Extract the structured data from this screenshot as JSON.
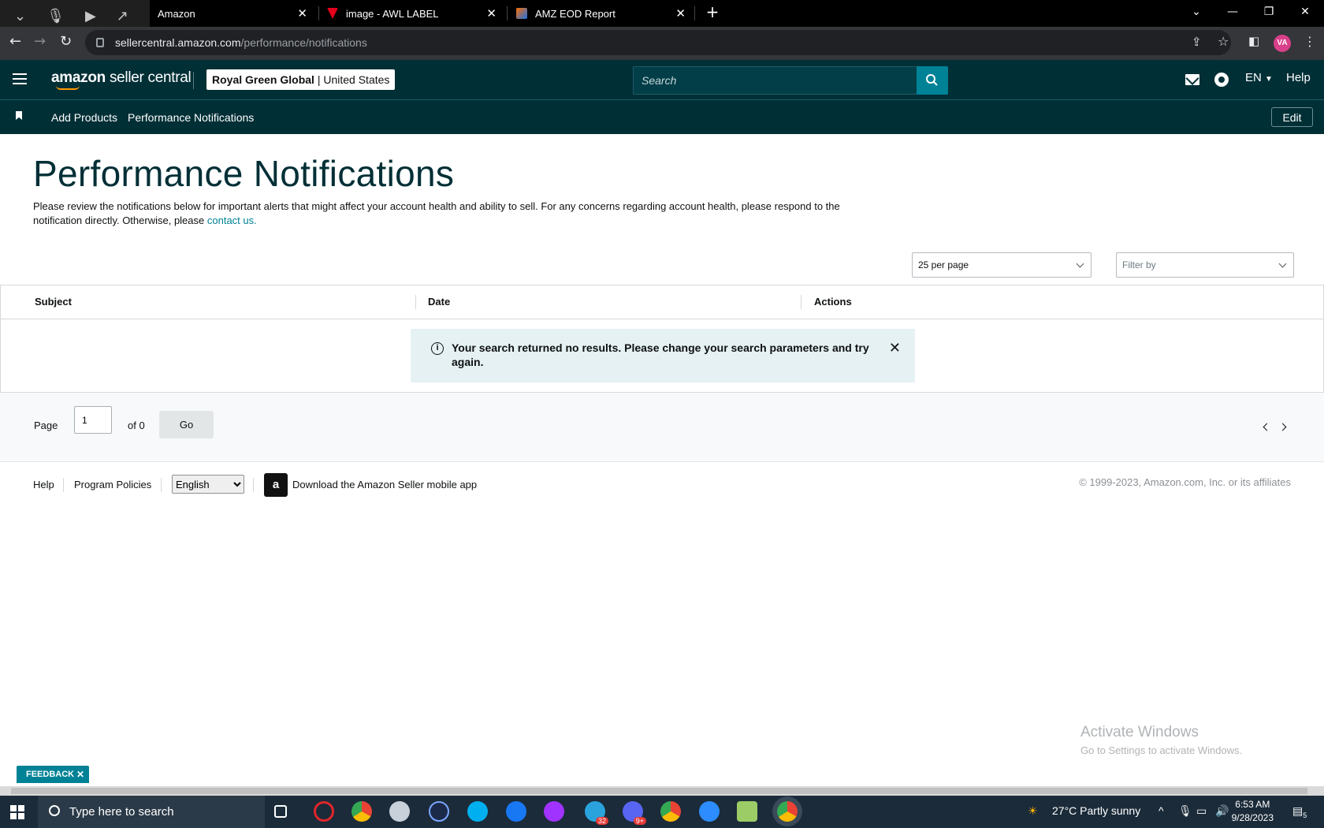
{
  "browser": {
    "tabs": [
      {
        "title": "Amazon",
        "favicon_color": "#1f1f1f"
      },
      {
        "title": "image - AWL LABEL",
        "favicon_color": "#e2001a"
      },
      {
        "title": "AMZ EOD Report",
        "favicon_color": "#ff6d00"
      }
    ],
    "url_host": "sellercentral.amazon.com",
    "url_path": "/performance/notifications",
    "profile_initials": "VA"
  },
  "header": {
    "logo_brand": "amazon",
    "logo_suffix": "seller central",
    "account_name": "Royal Green Global",
    "account_region": "United States",
    "search_placeholder": "Search",
    "language": "EN",
    "help": "Help"
  },
  "subnav": {
    "links": [
      "Add Products",
      "Performance Notifications"
    ],
    "edit": "Edit"
  },
  "page": {
    "title": "Performance Notifications",
    "intro": "Please review the notifications below for important alerts that might affect your account health and ability to sell. For any concerns regarding account health, please respond to the notification directly. Otherwise, please ",
    "intro_link": "contact us.",
    "per_page": "25 per page",
    "filter_placeholder": "Filter by"
  },
  "table": {
    "columns": [
      "Subject",
      "Date",
      "Actions"
    ],
    "empty_message": "Your search returned no results. Please change your search parameters and try again."
  },
  "pager": {
    "page_label": "Page",
    "current_page": "1",
    "of_label": "of 0",
    "go": "Go"
  },
  "footer": {
    "help": "Help",
    "policies": "Program Policies",
    "language_option": "English",
    "app_text": "Download the Amazon Seller mobile app",
    "copyright": "© 1999-2023, Amazon.com, Inc. or its affiliates"
  },
  "watermark": {
    "line1": "Activate Windows",
    "line2": "Go to Settings to activate Windows."
  },
  "feedback": "FEEDBACK",
  "taskbar": {
    "search_placeholder": "Type here to search",
    "weather": "27°C  Partly sunny",
    "time": "6:53 AM",
    "date": "9/28/2023",
    "notification_count": "5",
    "badges": {
      "telegram": "32",
      "discord": "9+"
    }
  }
}
